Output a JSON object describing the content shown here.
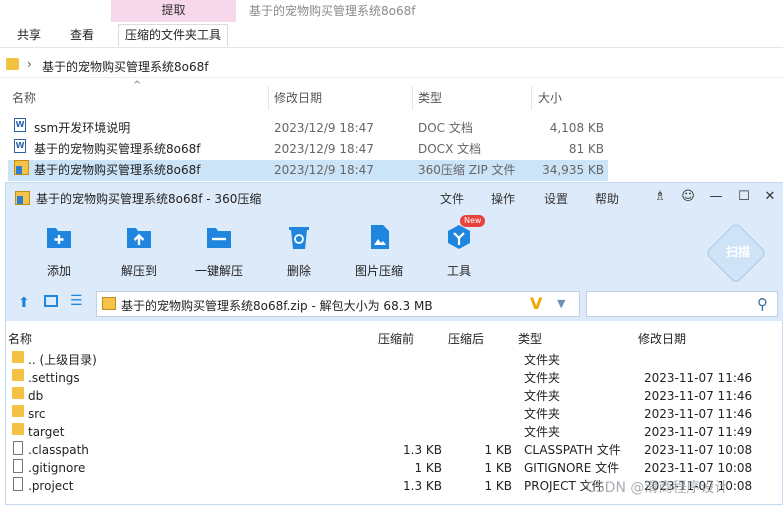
{
  "explorer": {
    "ribbon": {
      "context_tab": "提取",
      "window_title": "基于的宠物购买管理系统8o68f",
      "tabs": [
        "共享",
        "查看"
      ],
      "active_tab": "压缩的文件夹工具"
    },
    "address_path": "基于的宠物购买管理系统8o68f",
    "columns": {
      "name": "名称",
      "modified": "修改日期",
      "type": "类型",
      "size": "大小"
    },
    "files": [
      {
        "name": "ssm开发环境说明",
        "modified": "2023/12/9 18:47",
        "type": "DOC 文档",
        "size": "4,108 KB",
        "icon": "word-doc-icon"
      },
      {
        "name": "基于的宠物购买管理系统8o68f",
        "modified": "2023/12/9 18:47",
        "type": "DOCX 文档",
        "size": "81 KB",
        "icon": "word-doc-icon"
      },
      {
        "name": "基于的宠物购买管理系统8o68f",
        "modified": "2023/12/9 18:47",
        "type": "360压缩 ZIP 文件",
        "size": "34,935 KB",
        "icon": "zip-file-icon"
      }
    ]
  },
  "zip": {
    "title": "基于的宠物购买管理系统8o68f - 360压缩",
    "menu": [
      "文件",
      "操作",
      "设置",
      "帮助"
    ],
    "tools": [
      {
        "label": "添加",
        "icon": "add-icon"
      },
      {
        "label": "解压到",
        "icon": "extract-to-icon"
      },
      {
        "label": "一键解压",
        "icon": "one-click-extract-icon"
      },
      {
        "label": "删除",
        "icon": "recycle-icon"
      },
      {
        "label": "图片压缩",
        "icon": "image-compress-icon"
      },
      {
        "label": "工具",
        "icon": "tools-icon"
      }
    ],
    "new_badge": "New",
    "scan_label": "扫描",
    "address": "基于的宠物购买管理系统8o68f.zip - 解包大小为 68.3 MB",
    "columns": {
      "name": "名称",
      "compressed_before": "压缩前",
      "compressed_after": "压缩后",
      "type": "类型",
      "modified": "修改日期"
    },
    "rows": [
      {
        "name": ".. (上级目录)",
        "before": "",
        "after": "",
        "type": "文件夹",
        "modified": "",
        "icon": "folder-icon"
      },
      {
        "name": ".settings",
        "before": "",
        "after": "",
        "type": "文件夹",
        "modified": "2023-11-07 11:46",
        "icon": "folder-icon"
      },
      {
        "name": "db",
        "before": "",
        "after": "",
        "type": "文件夹",
        "modified": "2023-11-07 11:46",
        "icon": "folder-icon"
      },
      {
        "name": "src",
        "before": "",
        "after": "",
        "type": "文件夹",
        "modified": "2023-11-07 11:46",
        "icon": "folder-icon"
      },
      {
        "name": "target",
        "before": "",
        "after": "",
        "type": "文件夹",
        "modified": "2023-11-07 11:49",
        "icon": "folder-icon"
      },
      {
        "name": ".classpath",
        "before": "1.3 KB",
        "after": "1 KB",
        "type": "CLASSPATH 文件",
        "modified": "2023-11-07 10:08",
        "icon": "file-icon"
      },
      {
        "name": ".gitignore",
        "before": "1 KB",
        "after": "1 KB",
        "type": "GITIGNORE 文件",
        "modified": "2023-11-07 10:08",
        "icon": "file-icon"
      },
      {
        "name": ".project",
        "before": "1.3 KB",
        "after": "1 KB",
        "type": "PROJECT 文件",
        "modified": "2023-11-07 10:08",
        "icon": "file-icon"
      }
    ],
    "watermark": "CSDN @滑商程序设计"
  },
  "colors": {
    "accent": "#1f86e0",
    "window_bg": "#ddeafa",
    "selection": "#cce4f7",
    "context_tab": "#f7d7ea",
    "folder": "#f3c242",
    "badge": "#e8403a"
  }
}
